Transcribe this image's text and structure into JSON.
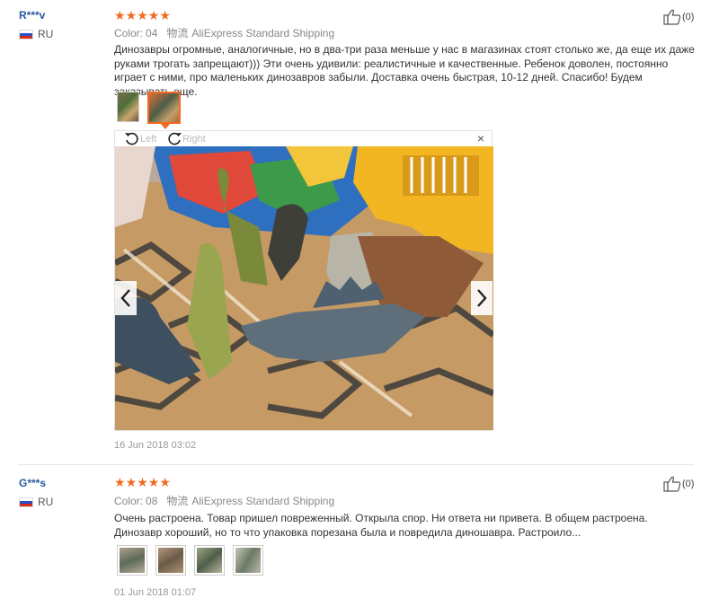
{
  "reviews": [
    {
      "user": "R***v",
      "country": "RU",
      "stars": 5,
      "color_label": "Color:",
      "color_value": "04",
      "shipping_label": "物流",
      "shipping_value": "AliExpress Standard Shipping",
      "helpful_count": "(0)",
      "text": "Динозавры огромные, аналогичные, но в два-три раза меньше у нас в магазинах стоят столько же, да еще их даже руками трогать запрещают))) Эти очень удивили: реалистичные и качественные. Ребенок доволен, постоянно играет с ними, про маленьких динозавров забыли. Доставка очень быстрая, 10-12 дней. Спасибо! Будем заказывать еще.",
      "date": "16 Jun 2018 03:02",
      "photo_count": 2,
      "viewer": {
        "rotate_left": "Left",
        "rotate_right": "Right",
        "close": "×"
      }
    },
    {
      "user": "G***s",
      "country": "RU",
      "stars": 5,
      "color_label": "Color:",
      "color_value": "08",
      "shipping_label": "物流",
      "shipping_value": "AliExpress Standard Shipping",
      "helpful_count": "(0)",
      "text": "Очень растроена. Товар пришел повреженный. Открыла спор. Ни ответа ни привета. В общем растроена. Динозавр хороший, но то что упаковка порезана была и повредила диношавра. Растроило...",
      "date": "01 Jun 2018 01:07",
      "photo_count": 4
    }
  ],
  "icons": {
    "star": "★",
    "thumb_up": "thumb-up-icon",
    "rotate_left": "rotate-left-icon",
    "rotate_right": "rotate-right-icon",
    "prev": "chevron-left-icon",
    "next": "chevron-right-icon"
  },
  "colors": {
    "star": "#f26a21",
    "user": "#2a5a9e",
    "accent": "#f26a21"
  }
}
